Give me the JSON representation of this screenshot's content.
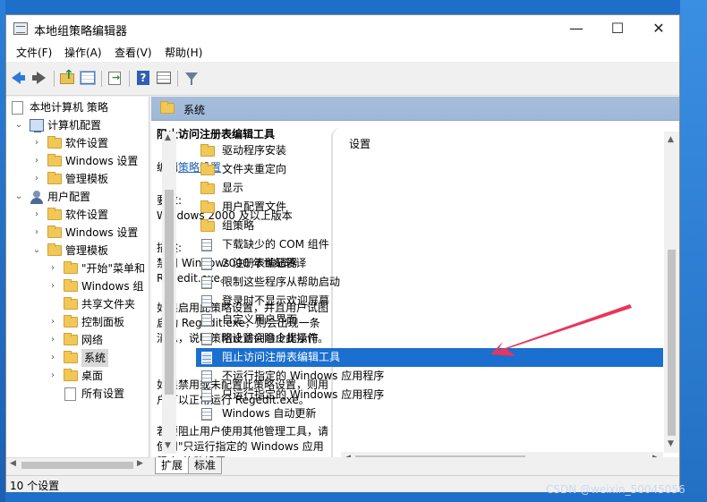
{
  "window": {
    "title": "本地组策略编辑器",
    "minimize": "—",
    "maximize": "☐",
    "close": "✕"
  },
  "menu": [
    "文件(F)",
    "操作(A)",
    "查看(V)",
    "帮助(H)"
  ],
  "tree": {
    "root": "本地计算机 策略",
    "nodes": [
      {
        "label": "计算机配置"
      },
      {
        "label": "软件设置"
      },
      {
        "label": "Windows 设置"
      },
      {
        "label": "管理模板"
      },
      {
        "label": "用户配置"
      },
      {
        "label": "软件设置"
      },
      {
        "label": "Windows 设置"
      },
      {
        "label": "管理模板"
      },
      {
        "label": "\"开始\"菜单和"
      },
      {
        "label": "Windows 组"
      },
      {
        "label": "共享文件夹"
      },
      {
        "label": "控制面板"
      },
      {
        "label": "网络"
      },
      {
        "label": "系统"
      },
      {
        "label": "桌面"
      },
      {
        "label": "所有设置"
      }
    ]
  },
  "right_header": "系统",
  "description": {
    "title": "阻止访问注册表编辑工具",
    "edit_prefix": "编辑",
    "edit_link": "策略设置",
    "requirements_label": "要求:",
    "requirements_value": "Windows 2000 及以上版本",
    "desc_label": "描述:",
    "desc_1": "禁用 Windows 注册表编辑器 Regedit.exe。",
    "desc_2": "如果启用此策略设置，并且用户试图启动 Regedit.exe，则会出现一条消息，说明策略设置会阻止此操作。",
    "desc_3": "如果禁用或未配置此策略设置，则用户可以正常运行 Regedit.exe。",
    "desc_4": "若要阻止用户使用其他管理工具，请使用\"只运行指定的 Windows 应用程序\"策略设置。"
  },
  "list": {
    "header": "设置",
    "items": [
      {
        "label": "驱动程序安装",
        "kind": "folder"
      },
      {
        "label": "文件夹重定向",
        "kind": "folder"
      },
      {
        "label": "显示",
        "kind": "folder"
      },
      {
        "label": "用户配置文件",
        "kind": "folder"
      },
      {
        "label": "组策略",
        "kind": "folder"
      },
      {
        "label": "下载缺少的 COM 组件",
        "kind": "policy"
      },
      {
        "label": "2000 年世纪转译",
        "kind": "policy"
      },
      {
        "label": "限制这些程序从帮助启动",
        "kind": "policy"
      },
      {
        "label": "登录时不显示欢迎屏幕",
        "kind": "policy"
      },
      {
        "label": "自定义用户界面",
        "kind": "policy"
      },
      {
        "label": "阻止访问命令提示符",
        "kind": "policy"
      },
      {
        "label": "阻止访问注册表编辑工具",
        "kind": "policy",
        "selected": true
      },
      {
        "label": "不运行指定的 Windows 应用程序",
        "kind": "policy"
      },
      {
        "label": "只运行指定的 Windows 应用程序",
        "kind": "policy"
      },
      {
        "label": "Windows 自动更新",
        "kind": "policy"
      }
    ]
  },
  "tabs": [
    "扩展",
    "标准"
  ],
  "status": "10 个设置",
  "watermark": "CSDN @weixin_50045056",
  "colors": {
    "selection": "#1a6fcf",
    "annotation_arrow": "#e8365a"
  }
}
